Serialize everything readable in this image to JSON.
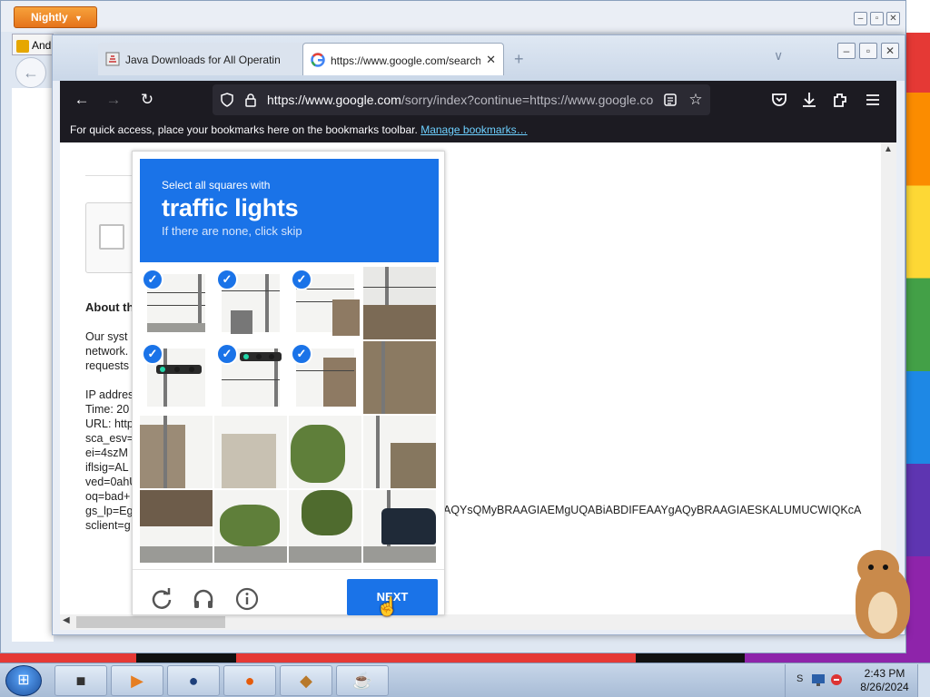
{
  "background_window": {
    "app_button_label": "Nightly",
    "tab_label": "And",
    "controls": [
      "–",
      "▫",
      "✕"
    ]
  },
  "window": {
    "tabs": [
      {
        "title": "Java Downloads for All Operating",
        "close": "✕",
        "active": false
      },
      {
        "title": "https://www.google.com/search",
        "close": "✕",
        "active": true
      }
    ],
    "new_tab": "+",
    "overflow": "∨",
    "controls": {
      "minimize": "–",
      "maximize": "▫",
      "close": "✕"
    }
  },
  "navbar": {
    "back": "←",
    "forward": "→",
    "reload": "↻",
    "url_domain": "https://www.google.com",
    "url_rest": "/sorry/index?continue=https://www.google.co",
    "icons": [
      "pocket-icon",
      "download-icon",
      "extensions-icon",
      "menu-icon"
    ]
  },
  "bookmarks_bar": {
    "text": "For quick access, place your bookmarks here on the bookmarks toolbar.",
    "link": "Manage bookmarks…"
  },
  "page": {
    "about_heading": "About th",
    "para": "Our syst\nnetwork.\nrequests",
    "details": "IP addres\nTime: 20\nURL: http\nsca_esv=\nei=4szM\niflsig=AL\nved=0ahU\noq=bad+\ngs_lp=Eg\nsclient=g",
    "gs_lp_tail": "AQYsQMyBRAAGIAEMgUQABiABDIFEAAYgAQyBRAAGIAESKALUMUCWIQKcA"
  },
  "captcha": {
    "line1": "Select all squares with",
    "line2": "traffic lights",
    "line3": "If there are none, click skip",
    "next_label": "NEXT",
    "selected_tiles": [
      0,
      1,
      2,
      4,
      5,
      6
    ]
  },
  "taskbar": {
    "time": "2:43 PM",
    "date": "8/26/2024",
    "tray_letter": "S"
  },
  "colors": {
    "captcha_blue": "#1a73e8",
    "firefox_dark": "#1c1b22",
    "link": "#6dd0ff"
  }
}
